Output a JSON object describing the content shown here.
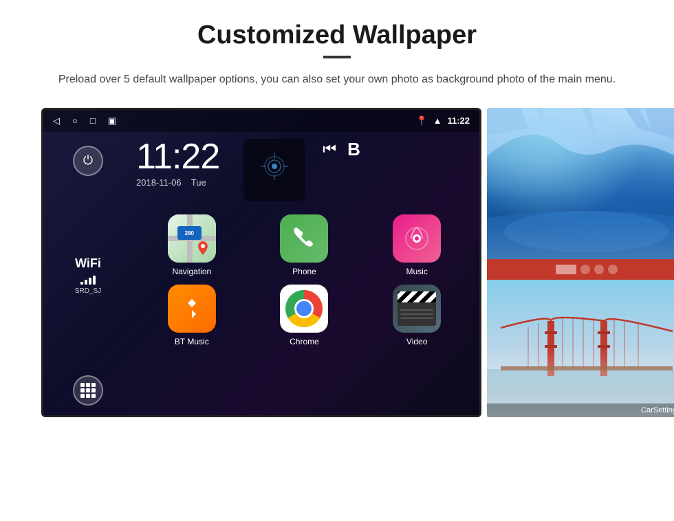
{
  "page": {
    "title": "Customized Wallpaper",
    "divider": true,
    "description": "Preload over 5 default wallpaper options, you can also set your own photo as background photo of the main menu."
  },
  "android": {
    "statusBar": {
      "time": "11:22",
      "icons": [
        "back-arrow",
        "home-circle",
        "square",
        "screenshot"
      ]
    },
    "clock": {
      "time": "11:22",
      "date": "2018-11-06",
      "day": "Tue"
    },
    "wifi": {
      "label": "WiFi",
      "ssid": "SRD_SJ"
    },
    "apps": [
      {
        "name": "Navigation",
        "icon": "maps"
      },
      {
        "name": "Phone",
        "icon": "phone"
      },
      {
        "name": "Music",
        "icon": "music"
      },
      {
        "name": "BT Music",
        "icon": "bluetooth"
      },
      {
        "name": "Chrome",
        "icon": "chrome"
      },
      {
        "name": "Video",
        "icon": "video"
      }
    ],
    "extraIcons": [
      "media-skip-back",
      "bluetooth-b"
    ],
    "bottomApps": [
      "CarSetting"
    ]
  },
  "wallpapers": {
    "top": "ice-cave",
    "bottom": "golden-gate-bridge",
    "bar": "pink-thumbnails"
  },
  "colors": {
    "background": "#ffffff",
    "title": "#1a1a1a",
    "android_bg_start": "#1a1a3e",
    "android_bg_end": "#0a0a1a",
    "ice_blue": "#87CEEB",
    "bridge_red": "#c0392b"
  }
}
